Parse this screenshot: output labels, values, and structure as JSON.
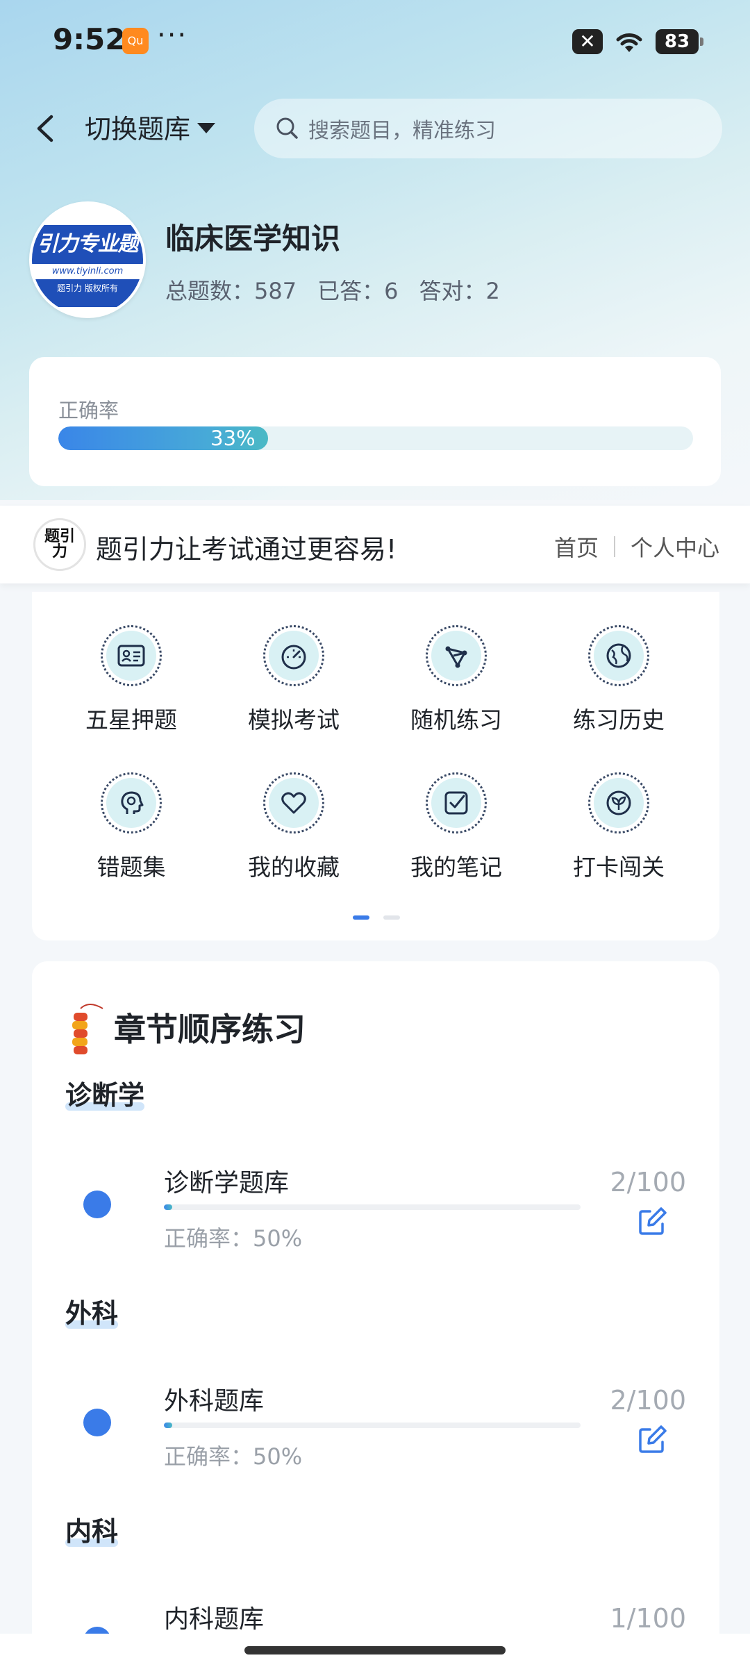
{
  "status_bar": {
    "time": "9:52",
    "app_badge": "Qu",
    "more": "···",
    "sim": "✕",
    "battery": "83"
  },
  "header": {
    "switch_label": "切换题库",
    "search_placeholder": "搜索题目，精准练习"
  },
  "profile": {
    "avatar_text": "引力专业题",
    "avatar_url": "www.tiyinli.com",
    "avatar_sub": "题引力 版权所有",
    "title": "临床医学知识",
    "total_label": "总题数：587",
    "answered_label": "已答：6",
    "correct_label": "答对：2"
  },
  "accuracy": {
    "label": "正确率",
    "percent_text": "33%",
    "percent": 33
  },
  "banner": {
    "logo_text": "题引力",
    "slogan": "题引力让考试通过更容易!",
    "home_link": "首页",
    "profile_link": "个人中心"
  },
  "features": [
    {
      "label": "五星押题",
      "icon": "id-card-icon"
    },
    {
      "label": "模拟考试",
      "icon": "gauge-icon"
    },
    {
      "label": "随机练习",
      "icon": "network-icon"
    },
    {
      "label": "练习历史",
      "icon": "globe-icon"
    },
    {
      "label": "错题集",
      "icon": "head-icon"
    },
    {
      "label": "我的收藏",
      "icon": "heart-icon"
    },
    {
      "label": "我的笔记",
      "icon": "checked-note-icon"
    },
    {
      "label": "打卡闯关",
      "icon": "sprout-icon"
    }
  ],
  "chapters": {
    "title": "章节顺序练习",
    "sections": [
      {
        "title": "诊断学",
        "item": {
          "name": "诊断学题库",
          "accuracy": "正确率：50%",
          "count": "2/100",
          "progress": 0.02
        }
      },
      {
        "title": "外科",
        "item": {
          "name": "外科题库",
          "accuracy": "正确率：50%",
          "count": "2/100",
          "progress": 0.02
        }
      },
      {
        "title": "内科",
        "item": {
          "name": "内科题库",
          "accuracy": "",
          "count": "1/100",
          "progress": 0.01
        }
      }
    ]
  },
  "colors": {
    "accent": "#3a7be8",
    "teal": "#4ab9c5",
    "icon_bg": "#d9f1f4"
  }
}
